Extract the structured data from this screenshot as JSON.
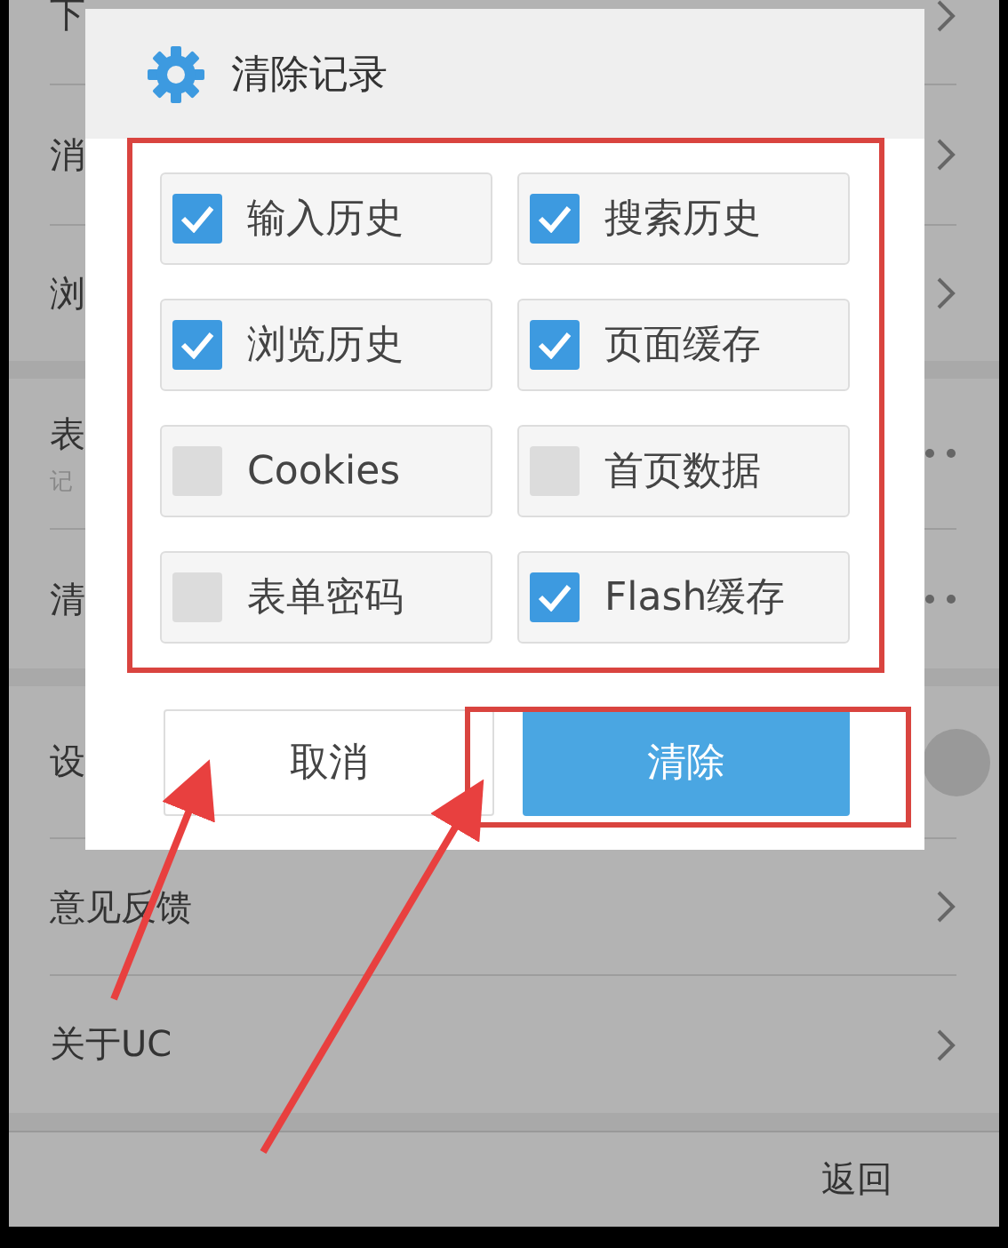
{
  "settings_sections": [
    [
      {
        "label": "下",
        "kind": "chevron"
      },
      {
        "label": "消",
        "kind": "chevron"
      },
      {
        "label": "浏",
        "kind": "chevron"
      }
    ],
    [
      {
        "label": "表",
        "subtitle": "记",
        "kind": "dots"
      },
      {
        "label": "清",
        "kind": "dots"
      }
    ],
    [
      {
        "label": "设",
        "kind": "toggle"
      },
      {
        "label": "意见反馈",
        "kind": "chevron"
      },
      {
        "label": "关于UC",
        "kind": "chevron"
      }
    ]
  ],
  "bottom_bar": {
    "label": "返回"
  },
  "dialog": {
    "title": "清除记录",
    "options": [
      {
        "label": "输入历史",
        "checked": true
      },
      {
        "label": "搜索历史",
        "checked": true
      },
      {
        "label": "浏览历史",
        "checked": true
      },
      {
        "label": "页面缓存",
        "checked": true
      },
      {
        "label": "Cookies",
        "checked": false
      },
      {
        "label": "首页数据",
        "checked": false
      },
      {
        "label": "表单密码",
        "checked": false
      },
      {
        "label": "Flash缓存",
        "checked": true
      }
    ],
    "buttons": [
      {
        "label": "取消",
        "kind": "secondary"
      },
      {
        "label": "清除",
        "kind": "primary"
      }
    ]
  }
}
